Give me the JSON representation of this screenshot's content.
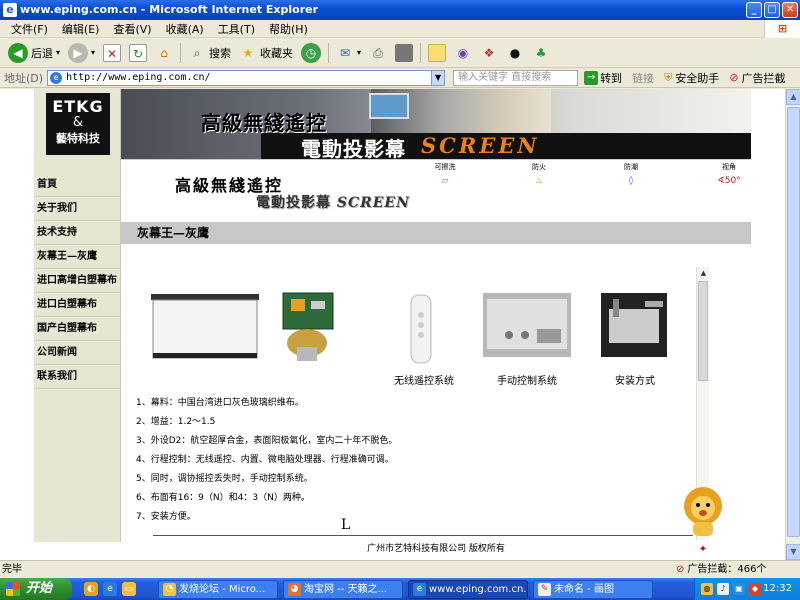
{
  "window": {
    "title": "www.eping.com.cn - Microsoft Internet Explorer",
    "minimize": "_",
    "maximize": "□",
    "close": "✕"
  },
  "menu": {
    "items": [
      "文件(F)",
      "编辑(E)",
      "查看(V)",
      "收藏(A)",
      "工具(T)",
      "帮助(H)"
    ]
  },
  "toolbar": {
    "back_label": "后退",
    "search_label": "搜索",
    "favorites_label": "收藏夹"
  },
  "address": {
    "label": "地址(D)",
    "url": "http://www.eping.com.cn/",
    "search_placeholder": "输入关键字 直接搜索",
    "go_label": "转到",
    "links_label": "链接",
    "security_label": "安全助手",
    "adblock_label": "广告拦截"
  },
  "site": {
    "logo": {
      "line1": "ETKG",
      "line2": "&",
      "line3": "藝特科技"
    },
    "banner": {
      "title_cn": "高級無綫遙控",
      "subtitle_cn": "電動投影幕",
      "subtitle_en": "SCREEN"
    },
    "features": [
      {
        "label": "可擦洗",
        "icon": "wash-icon",
        "color": "#2a9a8a",
        "symbol": "⏥"
      },
      {
        "label": "防火",
        "icon": "fire-icon",
        "color": "#e87818",
        "symbol": "♨"
      },
      {
        "label": "防潮",
        "icon": "drop-icon",
        "color": "#2a6ad8",
        "symbol": "◊"
      },
      {
        "label": "视角",
        "icon": "angle-icon",
        "color": "#c01818",
        "symbol": "∢50°"
      }
    ],
    "slogan_cn": "高級無綫遙控",
    "slogan2_cn": "電動投影幕",
    "slogan2_en": "SCREEN",
    "nav": [
      "首頁",
      "关于我们",
      "技术支持",
      "灰幕王—灰鹰",
      "进口高增白塑幕布",
      "进口白塑幕布",
      "国产白塑幕布",
      "公司新闻",
      "联系我们"
    ],
    "page_heading": "灰幕王—灰鹰",
    "products": [
      {
        "caption": ""
      },
      {
        "caption": ""
      },
      {
        "caption": "无线遥控系统"
      },
      {
        "caption": "手动控制系统"
      },
      {
        "caption": "安装方式"
      }
    ],
    "specs": [
      "1、幕料：中国台湾进口灰色玻璃织维布。",
      "2、增益：1.2～1.5",
      "3、外设D2：航空超厚合金，表面阳极氧化，室内二十年不脱色。",
      "4、行程控制：无线遥控、内置、微电脑处理器、行程准确可调。",
      "5、同时，调协摇控丢失时，手动控制系统。",
      "6、布面有16：9（N）和4：3（N）两种。",
      "7、安装方便。"
    ],
    "dimension_label": "L",
    "footer": "广州市艺特科技有限公司    版权所有"
  },
  "status": {
    "left": "完毕",
    "adblock": "广告拦截：466个"
  },
  "taskbar": {
    "start": "开始",
    "tasks": [
      {
        "label": "发烧论坛 - Micro...",
        "active": false
      },
      {
        "label": "淘宝网 -- 天籁之...",
        "active": false
      },
      {
        "label": "www.eping.com.cn...",
        "active": true
      },
      {
        "label": "未命名 - 画图",
        "active": false
      }
    ],
    "clock": "12:32"
  },
  "colors": {
    "title_bar": "#0a4fd0",
    "nav_bg": "#e6e6d2",
    "heading_bg": "#c7c7c7",
    "banner_accent": "#e8821a"
  }
}
